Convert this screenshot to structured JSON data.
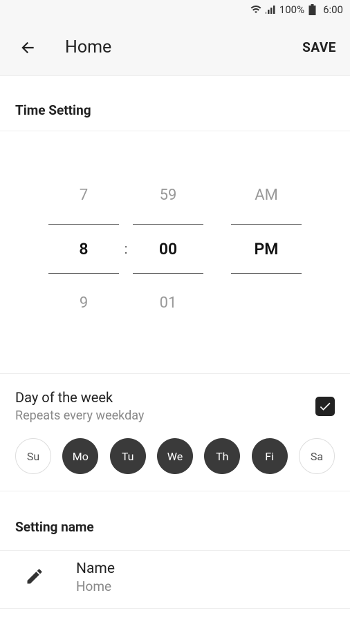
{
  "status_bar": {
    "battery_percent": "100%",
    "time": "6:00"
  },
  "header": {
    "title": "Home",
    "save_label": "SAVE"
  },
  "time_setting": {
    "section_label": "Time Setting",
    "hour_prev": "7",
    "hour_selected": "8",
    "hour_next": "9",
    "minute_prev": "59",
    "minute_selected": "00",
    "minute_next": "01",
    "ampm_prev": "AM",
    "ampm_selected": "PM",
    "colon": ":"
  },
  "day_of_week": {
    "title": "Day of the week",
    "subtitle": "Repeats every weekday",
    "enabled": true,
    "days": [
      {
        "label": "Su",
        "active": false
      },
      {
        "label": "Mo",
        "active": true
      },
      {
        "label": "Tu",
        "active": true
      },
      {
        "label": "We",
        "active": true
      },
      {
        "label": "Th",
        "active": true
      },
      {
        "label": "Fi",
        "active": true
      },
      {
        "label": "Sa",
        "active": false
      }
    ]
  },
  "setting_name": {
    "section_label": "Setting name",
    "label": "Name",
    "value": "Home"
  }
}
